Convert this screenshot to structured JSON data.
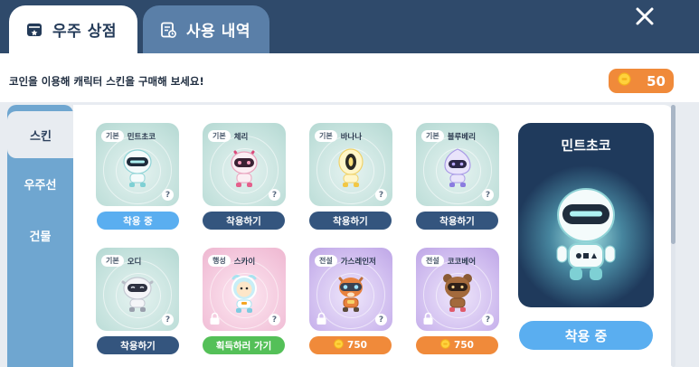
{
  "tabs": [
    {
      "label": "우주 상점",
      "icon": "store-icon",
      "active": true
    },
    {
      "label": "사용 내역",
      "icon": "history-icon",
      "active": false
    }
  ],
  "close_icon": "close-icon",
  "instruction": "코인을 이용해 캐릭터 스킨을 구매해 보세요!",
  "coins": {
    "icon": "coin-icon",
    "amount": "50"
  },
  "sidebar": {
    "items": [
      {
        "label": "스킨",
        "active": true
      },
      {
        "label": "우주선",
        "active": false
      },
      {
        "label": "건물",
        "active": false
      }
    ]
  },
  "skins": [
    {
      "grade": "기본",
      "name": "민트초코",
      "theme": "mint",
      "character": "mint-robot",
      "action": "착용 중",
      "state": "current"
    },
    {
      "grade": "기본",
      "name": "체리",
      "theme": "mint",
      "character": "cherry-robot",
      "action": "착용하기",
      "state": "wear"
    },
    {
      "grade": "기본",
      "name": "바나나",
      "theme": "mint",
      "character": "banana-robot",
      "action": "착용하기",
      "state": "wear"
    },
    {
      "grade": "기본",
      "name": "블루베리",
      "theme": "mint",
      "character": "blueberry-robot",
      "action": "착용하기",
      "state": "wear"
    },
    {
      "grade": "기본",
      "name": "오디",
      "theme": "mint",
      "character": "odi-robot",
      "action": "착용하기",
      "state": "wear"
    },
    {
      "grade": "행성",
      "name": "스카이",
      "theme": "pink",
      "character": "sky-astronaut",
      "action": "획득하러 가기",
      "state": "acquire",
      "locked": true
    },
    {
      "grade": "전설",
      "name": "가스레인저",
      "theme": "purple",
      "character": "gas-ranger",
      "action": "750",
      "state": "price",
      "locked": true
    },
    {
      "grade": "전설",
      "name": "코코베어",
      "theme": "purple",
      "character": "coco-bear",
      "action": "750",
      "state": "price",
      "locked": true
    }
  ],
  "preview": {
    "title": "민트초코",
    "action": "착용 중"
  },
  "colors": {
    "primary": "#2f4a6b",
    "accent_blue": "#5aaef0",
    "navy_button": "#34557e",
    "orange": "#f08a3a",
    "green": "#54c058"
  }
}
